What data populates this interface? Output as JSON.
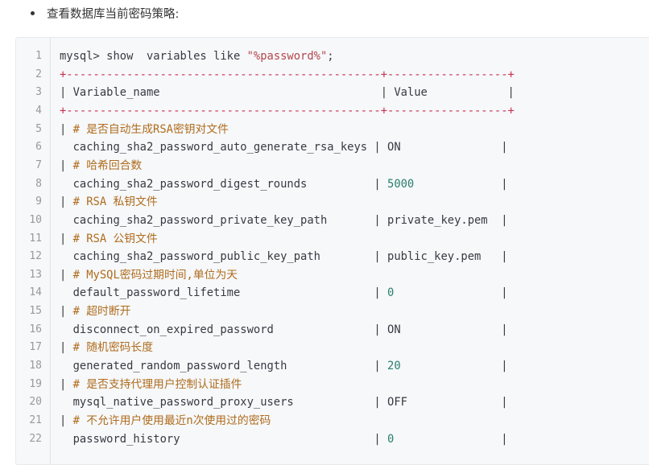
{
  "bullet_text": "查看数据库当前密码策略:",
  "code_lines": [
    {
      "n": "1",
      "parts": [
        [
          "plain",
          "mysql> show  variables like "
        ],
        [
          "str",
          "\"%password%\""
        ],
        [
          "plain",
          ";"
        ]
      ]
    },
    {
      "n": "2",
      "parts": [
        [
          "sep",
          "+-----------------------------------------------+------------------+"
        ]
      ]
    },
    {
      "n": "3",
      "parts": [
        [
          "plain",
          "| Variable_name                                 | Value            |"
        ]
      ]
    },
    {
      "n": "4",
      "parts": [
        [
          "sep",
          "+-----------------------------------------------+------------------+"
        ]
      ]
    },
    {
      "n": "5",
      "parts": [
        [
          "plain",
          "| "
        ],
        [
          "com",
          "# 是否自动生成RSA密钥对文件"
        ]
      ]
    },
    {
      "n": "6",
      "parts": [
        [
          "plain",
          "  caching_sha2_password_auto_generate_rsa_keys | ON               |"
        ]
      ]
    },
    {
      "n": "7",
      "parts": [
        [
          "plain",
          "| "
        ],
        [
          "com",
          "# 哈希回合数"
        ]
      ]
    },
    {
      "n": "8",
      "parts": [
        [
          "plain",
          "  caching_sha2_password_digest_rounds          | "
        ],
        [
          "num",
          "5000"
        ],
        [
          "plain",
          "             |"
        ]
      ]
    },
    {
      "n": "9",
      "parts": [
        [
          "plain",
          "| "
        ],
        [
          "com",
          "# RSA 私钥文件"
        ]
      ]
    },
    {
      "n": "10",
      "parts": [
        [
          "plain",
          "  caching_sha2_password_private_key_path       | private_key.pem  |"
        ]
      ]
    },
    {
      "n": "11",
      "parts": [
        [
          "plain",
          "| "
        ],
        [
          "com",
          "# RSA 公钥文件"
        ]
      ]
    },
    {
      "n": "12",
      "parts": [
        [
          "plain",
          "  caching_sha2_password_public_key_path        | public_key.pem   |"
        ]
      ]
    },
    {
      "n": "13",
      "parts": [
        [
          "plain",
          "| "
        ],
        [
          "com",
          "# MySQL密码过期时间,单位为天"
        ]
      ]
    },
    {
      "n": "14",
      "parts": [
        [
          "plain",
          "  default_password_lifetime                    | "
        ],
        [
          "num",
          "0"
        ],
        [
          "plain",
          "                |"
        ]
      ]
    },
    {
      "n": "15",
      "parts": [
        [
          "plain",
          "| "
        ],
        [
          "com",
          "# 超时断开"
        ]
      ]
    },
    {
      "n": "16",
      "parts": [
        [
          "plain",
          "  disconnect_on_expired_password               | ON               |"
        ]
      ]
    },
    {
      "n": "17",
      "parts": [
        [
          "plain",
          "| "
        ],
        [
          "com",
          "# 随机密码长度"
        ]
      ]
    },
    {
      "n": "18",
      "parts": [
        [
          "plain",
          "  generated_random_password_length             | "
        ],
        [
          "num",
          "20"
        ],
        [
          "plain",
          "               |"
        ]
      ]
    },
    {
      "n": "19",
      "parts": [
        [
          "plain",
          "| "
        ],
        [
          "com",
          "# 是否支持代理用户控制认证插件"
        ]
      ]
    },
    {
      "n": "20",
      "parts": [
        [
          "plain",
          "  mysql_native_password_proxy_users            | OFF              |"
        ]
      ]
    },
    {
      "n": "21",
      "parts": [
        [
          "plain",
          "| "
        ],
        [
          "com",
          "# 不允许用户使用最近n次使用过的密码"
        ]
      ]
    },
    {
      "n": "22",
      "parts": [
        [
          "plain",
          "  password_history                             | "
        ],
        [
          "num",
          "0"
        ],
        [
          "plain",
          "                |"
        ]
      ]
    }
  ],
  "colors": {
    "string": "#b5464d",
    "separator": "#c8304e",
    "comment": "#b06c1d",
    "number": "#2a7f6f",
    "line_number": "#999999",
    "code_bg": "#f6f8fa"
  }
}
